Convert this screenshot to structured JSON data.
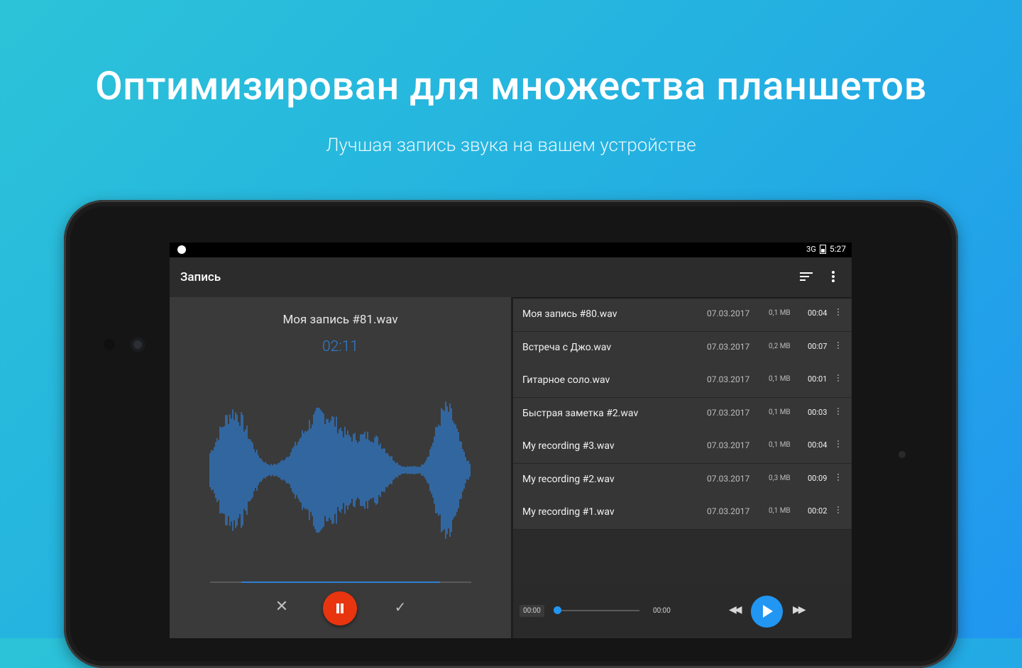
{
  "marketing": {
    "headline": "Оптимизирован для множества планшетов",
    "subline": "Лучшая запись звука на вашем устройстве"
  },
  "statusbar": {
    "network": "3G",
    "time": "5:27"
  },
  "appbar": {
    "title": "Запись",
    "sort_icon": "sort-icon",
    "more_icon": "more-vert-icon"
  },
  "recorder": {
    "file_name": "Моя запись #81.wav",
    "elapsed": "02:11",
    "accent_color": "#2f7fd6",
    "record_button_color": "#e8350f",
    "controls": [
      "close-icon",
      "pause-icon",
      "check-icon"
    ]
  },
  "recordings": [
    {
      "name": "Моя запись #80.wav",
      "date": "07.03.2017",
      "size": "0,1 MB",
      "duration": "00:04"
    },
    {
      "name": "Встреча с Джо.wav",
      "date": "07.03.2017",
      "size": "0,2 MB",
      "duration": "00:07"
    },
    {
      "name": "Гитарное соло.wav",
      "date": "07.03.2017",
      "size": "0,1 MB",
      "duration": "00:01"
    },
    {
      "name": "Быстрая заметка #2.wav",
      "date": "07.03.2017",
      "size": "0,1 MB",
      "duration": "00:03"
    },
    {
      "name": "My recording #3.wav",
      "date": "07.03.2017",
      "size": "0,1 MB",
      "duration": "00:04"
    },
    {
      "name": "My recording #2.wav",
      "date": "07.03.2017",
      "size": "0,3 MB",
      "duration": "00:09"
    },
    {
      "name": "My recording #1.wav",
      "date": "07.03.2017",
      "size": "0,1 MB",
      "duration": "00:02"
    }
  ],
  "player": {
    "current": "00:00",
    "total": "00:00",
    "progress": 0,
    "accent_color": "#2196f3"
  }
}
